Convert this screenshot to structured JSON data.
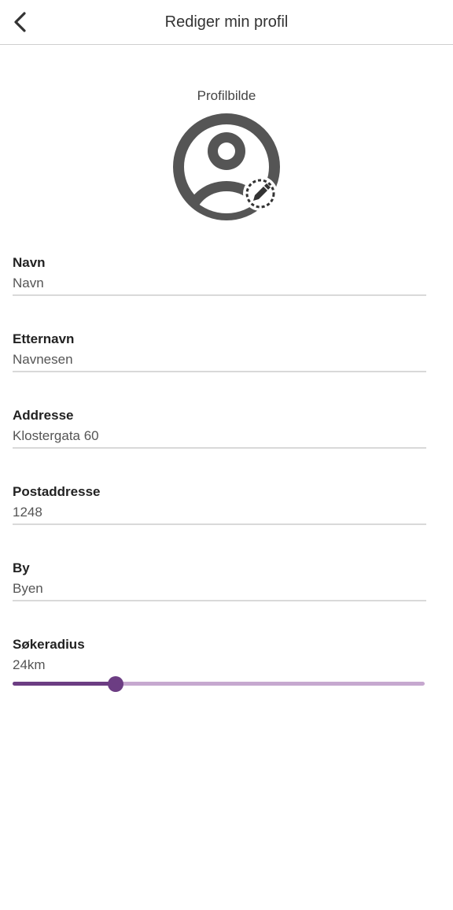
{
  "header": {
    "title": "Rediger min profil",
    "back_icon": "chevron-left-icon"
  },
  "avatar": {
    "label": "Profilbilde",
    "icon": "account-circle-icon",
    "edit_icon": "pencil-icon"
  },
  "fields": [
    {
      "label": "Navn",
      "value": "Navn"
    },
    {
      "label": "Etternavn",
      "value": "Navnesen"
    },
    {
      "label": "Addresse",
      "value": "Klostergata 60"
    },
    {
      "label": "Postaddresse",
      "value": "1248"
    },
    {
      "label": "By",
      "value": "Byen"
    }
  ],
  "radius": {
    "label": "Søkeradius",
    "value_text": "24km",
    "fraction": 0.25
  },
  "colors": {
    "accent": "#6c3d83",
    "accent_light": "#c6a8cf",
    "icon": "#555555"
  }
}
